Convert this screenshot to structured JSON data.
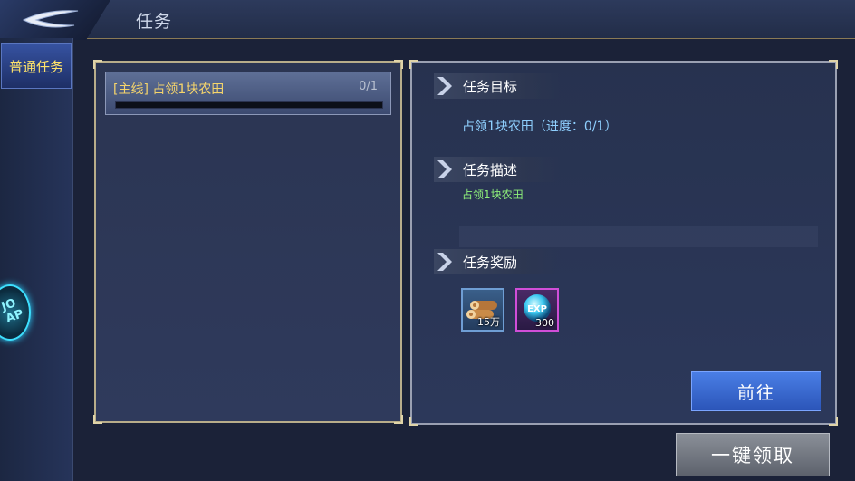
{
  "header": {
    "title": "任务"
  },
  "sidebar": {
    "tabs": [
      {
        "label": "普通任务",
        "selected": true
      }
    ],
    "badge_text": "JO AP"
  },
  "quest_list": {
    "items": [
      {
        "name": "[主线] 占领1块农田",
        "count": "0/1",
        "progress": 0
      }
    ]
  },
  "detail": {
    "goal_title": "任务目标",
    "goal_text": "占领1块农田（进度：0/1）",
    "desc_title": "任务描述",
    "desc_text": "占领1块农田",
    "reward_title": "任务奖励",
    "rewards": [
      {
        "icon": "wood-icon",
        "qty": "15万"
      },
      {
        "icon": "exp-orb-icon",
        "qty": "300"
      }
    ],
    "go_button": "前往"
  },
  "footer": {
    "claim_all_button": "一键领取"
  },
  "colors": {
    "accent": "#ffe36a",
    "goal_text": "#8fd0ff",
    "desc_text": "#8ef07a",
    "go_button": "#3a6ad6",
    "claim_button": "#767b84"
  }
}
